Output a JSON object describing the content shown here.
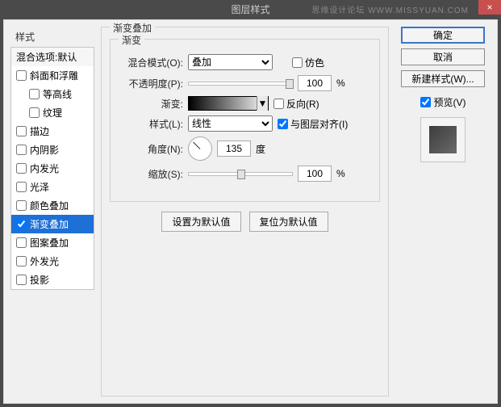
{
  "titlebar": {
    "title": "图层样式",
    "close": "×",
    "watermark": "思缘设计论坛 WWW.MISSYUAN.COM"
  },
  "left": {
    "header": "样式",
    "blend_options": "混合选项:默认",
    "items": {
      "bevel": "斜面和浮雕",
      "contour": "等高线",
      "texture": "纹理",
      "stroke": "描边",
      "innershadow": "内阴影",
      "innerglow": "内发光",
      "satin": "光泽",
      "coloroverlay": "颜色叠加",
      "gradientoverlay": "渐变叠加",
      "patternoverlay": "图案叠加",
      "outerglow": "外发光",
      "dropshadow": "投影"
    }
  },
  "group": {
    "title": "渐变叠加",
    "subtitle": "渐变",
    "blendmode_label": "混合模式(O):",
    "blendmode_value": "叠加",
    "dither": "仿色",
    "opacity_label": "不透明度(P):",
    "opacity_value": "100",
    "percent": "%",
    "gradient_label": "渐变:",
    "reverse": "反向(R)",
    "style_label": "样式(L):",
    "style_value": "线性",
    "align": "与图层对齐(I)",
    "angle_label": "角度(N):",
    "angle_value": "135",
    "degree": "度",
    "scale_label": "缩放(S):",
    "scale_value": "100",
    "set_default": "设置为默认值",
    "reset_default": "复位为默认值"
  },
  "right": {
    "ok": "确定",
    "cancel": "取消",
    "newstyle": "新建样式(W)...",
    "preview": "预览(V)"
  }
}
